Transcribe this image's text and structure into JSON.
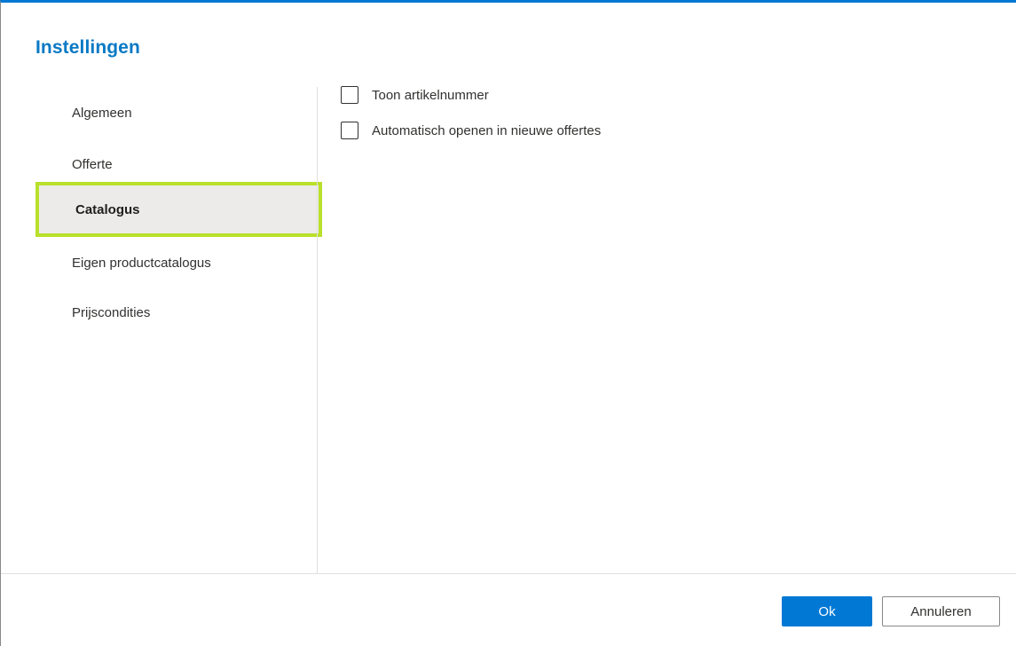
{
  "dialog": {
    "title": "Instellingen"
  },
  "nav": {
    "items": [
      {
        "label": "Algemeen",
        "selected": false
      },
      {
        "label": "Offerte",
        "selected": false
      },
      {
        "label": "Catalogus",
        "selected": true
      },
      {
        "label": "Eigen productcatalogus",
        "selected": false
      },
      {
        "label": "Prijscondities",
        "selected": false
      }
    ]
  },
  "content": {
    "options": [
      {
        "label": "Toon artikelnummer",
        "checked": false
      },
      {
        "label": "Automatisch openen in nieuwe offertes",
        "checked": false
      }
    ]
  },
  "footer": {
    "ok_label": "Ok",
    "cancel_label": "Annuleren"
  },
  "colors": {
    "accent": "#0078d4",
    "title": "#0a79c5",
    "selection_highlight": "#b9e02a",
    "selected_background": "#edebe9"
  }
}
